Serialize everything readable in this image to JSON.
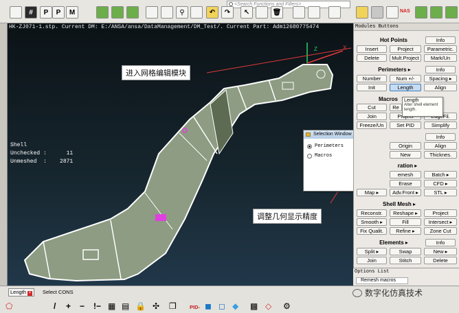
{
  "toolbar": {
    "search_placeholder": "<Search Functions and Filters>",
    "nas_label": "NAS",
    "buttons": [
      "select",
      "entity-id",
      "properties",
      "materials",
      "add",
      "copy",
      "new",
      "view",
      "zoom",
      "find",
      "undo",
      "redo",
      "cursor",
      "color",
      "delete",
      "measure",
      "transform",
      "settings"
    ]
  },
  "viewport": {
    "header": "HK-ZJ071-1.stp.   Current DM: E:/ANSA/ansa/DataManagement/DM_Test/.   Current Part: Adm12680775474",
    "shell_stats": "Shell\nUnchecked :      11\nUnmeshed  :    2871",
    "axis_x": "X",
    "axis_z": "Z",
    "annotation_1": "进入网格编辑模块",
    "annotation_2": "调整几何显示精度",
    "part_colors": {
      "shell": "#8d9c82",
      "face_dark": "#5d6b52",
      "outline": "#ffffff",
      "marker": "#e040e0"
    }
  },
  "selection_window": {
    "title": "Selection Window",
    "options": [
      {
        "label": "Perimeters",
        "selected": true
      },
      {
        "label": "Macros",
        "selected": false
      }
    ]
  },
  "panel": {
    "title": "Modules Buttons",
    "hot_points": {
      "label": "Hot Points",
      "buttons": [
        "Info",
        "Insert",
        "Project",
        "Parametric.",
        "Delete",
        "Mult.Project",
        "Mark/Un"
      ]
    },
    "perimeters": {
      "label": "Perimeters ▸",
      "buttons": [
        "Info",
        "Number",
        "Num +/-",
        "Spacing ▸",
        "Init",
        "Length",
        "Align"
      ]
    },
    "macros": {
      "label": "Macros",
      "buttons": [
        "Cut",
        "Re",
        "Join",
        "Project",
        "EdgeFil.",
        "Freeze/Un",
        "Set PID",
        "Simplify"
      ]
    },
    "tooltip": {
      "title": "Length",
      "body": "Alter shell element length."
    },
    "row_a": {
      "buttons": [
        "Info",
        "Origin",
        "Align",
        "New",
        "Thicknes."
      ]
    },
    "generation": {
      "label": "ration ▸",
      "buttons": [
        "emesh",
        "Batch ▸",
        "Erase",
        "CFD ▸",
        "Map ▸",
        "Adv.Front ▸",
        "STL ▸"
      ]
    },
    "shell_mesh": {
      "label": "Shell Mesh ▸",
      "buttons": [
        "Reconstr.",
        "Reshape ▸",
        "Project",
        "Smooth ▸",
        "Fill",
        "Intersect ▸",
        "Fix Qualit.",
        "Refine ▸",
        "Zone Cut"
      ]
    },
    "elements": {
      "label": "Elements ▸",
      "buttons": [
        "Info",
        "Split ▸",
        "Swap",
        "New ▸",
        "Join",
        "Stitch",
        "Delete"
      ]
    },
    "options_list": {
      "title": "Options List",
      "item": "Remesh macros"
    }
  },
  "bottombar": {
    "length_tag": "Length",
    "select_cons": "Select CONS",
    "pid_label": "PID-",
    "watermark": "数字化仿真技术"
  }
}
